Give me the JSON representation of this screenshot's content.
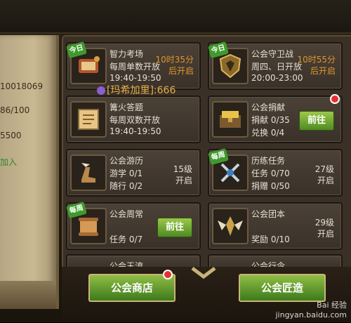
{
  "left_panel": {
    "lines": [
      "10018069",
      "86/100",
      "5500",
      "加入"
    ]
  },
  "chat": {
    "text": "[玛希加里]:666"
  },
  "activities": [
    {
      "title": "智力考场",
      "line1": "每周单数开放",
      "line2": "19:40-19:50",
      "timer": "10时35分",
      "timer_sub": "后开启",
      "tag": "今日",
      "icon": "scroll-quiz-icon"
    },
    {
      "title": "公会守卫战",
      "line1": "周四、日开放",
      "line2": "20:00-23:00",
      "timer": "10时55分",
      "timer_sub": "后开启",
      "tag": "今日",
      "icon": "shield-guard-icon"
    },
    {
      "title": "篝火答题",
      "line1": "每周双数开放",
      "line2": "19:40-19:50",
      "icon": "bonfire-quiz-icon"
    },
    {
      "title": "公会捐献",
      "line1": "捐献 0/35",
      "line2": "兑换 0/4",
      "button": "前往",
      "icon": "treasure-chest-icon"
    },
    {
      "title": "公会游历",
      "line1": "游学 0/1",
      "line2": "随行 0/2",
      "level": "15级",
      "level_sub": "开启",
      "icon": "winged-boot-icon"
    },
    {
      "title": "历练任务",
      "line1": "任务 0/70",
      "line2": "捐赠 0/50",
      "level": "27级",
      "level_sub": "开启",
      "tag": "每周",
      "icon": "crossed-swords-icon"
    },
    {
      "title": "公会周常",
      "line1": "任务 0/7",
      "button": "前往",
      "tag": "每周",
      "icon": "scroll-weekly-icon"
    },
    {
      "title": "公会团本",
      "line1": "奖励 0/10",
      "level": "29级",
      "level_sub": "开启",
      "icon": "winged-emblem-icon"
    },
    {
      "title": "公会玉流"
    },
    {
      "title": "公会行令"
    }
  ],
  "bottom": {
    "shop_button": "公会商店",
    "craft_button": "公会匠造"
  },
  "watermark": {
    "line1": "Bai 经验",
    "line2": "jingyan.baidu.com"
  },
  "colors": {
    "accent_orange": "#e0952c",
    "button_green": "#5f9a2a",
    "text_light": "#e6e0d2"
  }
}
